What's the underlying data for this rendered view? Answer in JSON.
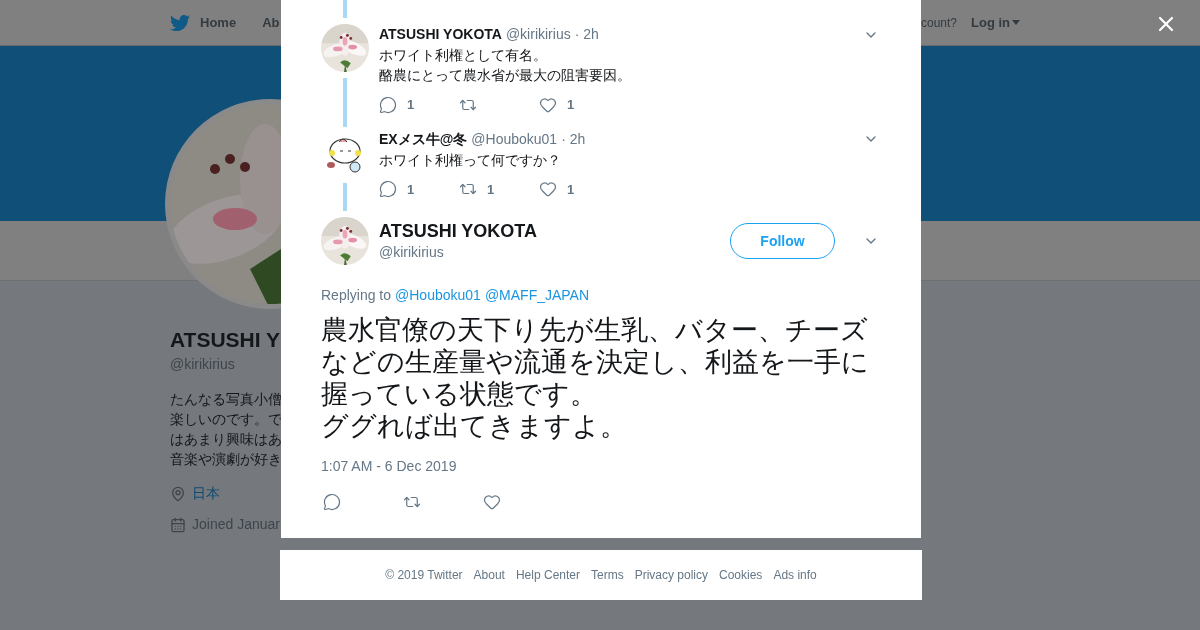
{
  "background_page": {
    "nav": {
      "items": [
        {
          "label": "Home"
        },
        {
          "label": "Ab"
        }
      ],
      "account_prompt": "count?",
      "login": "Log in"
    },
    "profile": {
      "name": "ATSUSHI Y",
      "handle": "@kirikirius",
      "bio_lines": [
        "たんなる写真小僧",
        "楽しいのです。で",
        "はあまり興味はあ",
        "音楽や演劇が好き"
      ],
      "location": "日本",
      "joined": "Joined Januar"
    }
  },
  "modal": {
    "replies": [
      {
        "name": "ATSUSHI YOKOTA",
        "handle": "@kirikirius",
        "time": "· 2h",
        "kind": "picture",
        "lines": [
          "ホワイト利権として有名。",
          "酪農にとって農水省が最大の阻害要因。"
        ],
        "reply_count": "1",
        "like_count": "1"
      },
      {
        "name": "EXメス牛@冬",
        "handle": "@Houboku01",
        "time": "· 2h",
        "kind": "cartoon",
        "lines": [
          "ホワイト利権って何ですか？"
        ],
        "reply_count": "1",
        "retweet_count": "1",
        "like_count": "1"
      }
    ],
    "tweet": {
      "name": "ATSUSHI YOKOTA",
      "handle": "@kirikirius",
      "follow": "Follow",
      "replying_label": "Replying to",
      "replying_to": [
        "@Houboku01",
        "@MAFF_JAPAN"
      ],
      "lines": [
        "農水官僚の天下り先が生乳、バター、チーズなどの生産量や流通を決定し、利益を一手に握っている状態です。",
        "ググれば出てきますよ。"
      ],
      "timestamp": "1:07 AM - 6 Dec 2019"
    }
  },
  "footer": {
    "links": [
      "© 2019 Twitter",
      "About",
      "Help Center",
      "Terms",
      "Privacy policy",
      "Cookies",
      "Ads info"
    ]
  }
}
